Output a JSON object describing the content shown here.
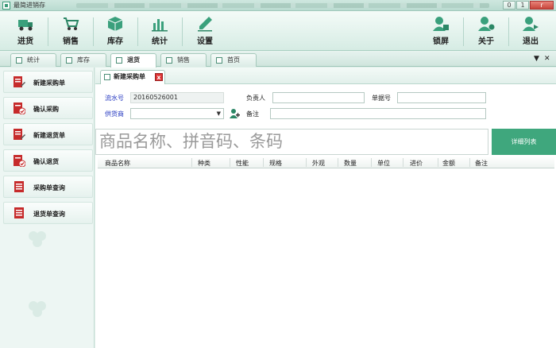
{
  "window": {
    "title": "最简进销存",
    "min": "0",
    "max": "1",
    "close": "r"
  },
  "toolbar": {
    "left": [
      {
        "label": "进货",
        "icon": "truck-icon"
      },
      {
        "label": "销售",
        "icon": "cart-icon"
      },
      {
        "label": "库存",
        "icon": "box-icon"
      },
      {
        "label": "统计",
        "icon": "bar-chart-icon"
      },
      {
        "label": "设置",
        "icon": "pencil-icon"
      }
    ],
    "right": [
      {
        "label": "锁屏",
        "icon": "user-lock-icon"
      },
      {
        "label": "关于",
        "icon": "user-info-icon"
      },
      {
        "label": "退出",
        "icon": "user-exit-icon"
      }
    ]
  },
  "main_tabs": [
    {
      "label": "统计",
      "active": false
    },
    {
      "label": "库存",
      "active": false
    },
    {
      "label": "退货",
      "active": true
    },
    {
      "label": "销售",
      "active": false
    },
    {
      "label": "首页",
      "active": false
    }
  ],
  "tab_controls": {
    "menu": "▼",
    "close": "✕"
  },
  "left_nav": [
    {
      "label": "新建采购单",
      "icon": "new-order-icon"
    },
    {
      "label": "确认采购",
      "icon": "confirm-icon"
    },
    {
      "label": "新建退货单",
      "icon": "new-order-icon"
    },
    {
      "label": "确认退货",
      "icon": "confirm-icon"
    },
    {
      "label": "采购单查询",
      "icon": "list-icon"
    },
    {
      "label": "退货单查询",
      "icon": "list-icon"
    }
  ],
  "sub_tab": {
    "label": "新建采购单",
    "close": "x"
  },
  "form": {
    "serial_label": "流水号",
    "serial_value": "20160526001",
    "person_label": "负责人",
    "person_value": "",
    "bill_label": "单据号",
    "bill_value": "",
    "supplier_label": "供货商",
    "supplier_value": "",
    "note_label": "备注",
    "note_value": ""
  },
  "search": {
    "placeholder": "商品名称、拼音码、条码"
  },
  "detail_button": "详细列表",
  "grid": {
    "columns": [
      "商品名称",
      "种类",
      "性能",
      "规格",
      "外观",
      "数量",
      "单位",
      "进价",
      "金额",
      "备注"
    ],
    "rows": []
  },
  "colors": {
    "accent": "#3fa77d",
    "toolbar_bg": "#e7f3ef",
    "link_blue": "#2437c0",
    "icon_red": "#c62b2b"
  }
}
